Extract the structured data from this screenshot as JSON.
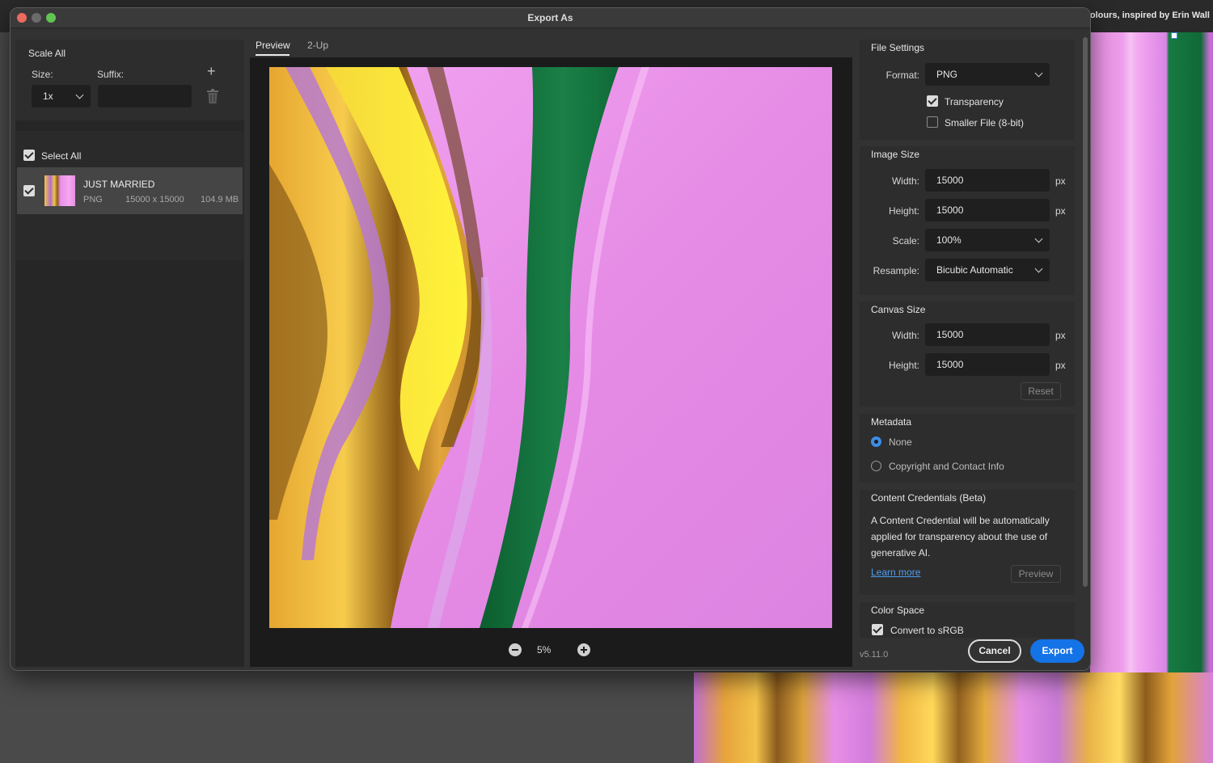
{
  "background": {
    "doc_title": "olours, inspired by  Erin Wall"
  },
  "dialog": {
    "title": "Export As",
    "version": "v5.11.0",
    "cancel_label": "Cancel",
    "export_label": "Export"
  },
  "scale_all": {
    "title": "Scale All",
    "size_label": "Size:",
    "suffix_label": "Suffix:",
    "size_value": "1x",
    "suffix_value": "",
    "add_icon": "plus-icon",
    "delete_icon": "trash-icon"
  },
  "assets": {
    "select_all_label": "Select All",
    "select_all_checked": true,
    "items": [
      {
        "name": "JUST MARRIED",
        "format": "PNG",
        "dimensions": "15000 x 15000",
        "size": "104.9 MB",
        "checked": true
      }
    ]
  },
  "preview": {
    "tabs": [
      "Preview",
      "2-Up"
    ],
    "active_tab": "Preview",
    "zoom": "5%"
  },
  "file_settings": {
    "title": "File Settings",
    "format_label": "Format:",
    "format_value": "PNG",
    "transparency_label": "Transparency",
    "transparency_checked": true,
    "smaller_file_label": "Smaller File (8-bit)",
    "smaller_file_checked": false
  },
  "image_size": {
    "title": "Image Size",
    "width_label": "Width:",
    "width_value": "15000",
    "height_label": "Height:",
    "height_value": "15000",
    "scale_label": "Scale:",
    "scale_value": "100%",
    "resample_label": "Resample:",
    "resample_value": "Bicubic Automatic",
    "unit": "px"
  },
  "canvas_size": {
    "title": "Canvas Size",
    "width_label": "Width:",
    "width_value": "15000",
    "height_label": "Height:",
    "height_value": "15000",
    "unit": "px",
    "reset_label": "Reset"
  },
  "metadata": {
    "title": "Metadata",
    "options": [
      "None",
      "Copyright and Contact Info"
    ],
    "selected": "None"
  },
  "content_credentials": {
    "title": "Content Credentials (Beta)",
    "text": "A Content Credential will be automatically applied for transparency about the use of generative AI.",
    "learn_more": "Learn more",
    "preview_label": "Preview"
  },
  "color_space": {
    "title": "Color Space",
    "convert_label": "Convert to sRGB",
    "convert_checked": true
  },
  "colors": {
    "accent": "#1473e6",
    "link": "#4d9df0",
    "radio": "#3b8ee6"
  }
}
